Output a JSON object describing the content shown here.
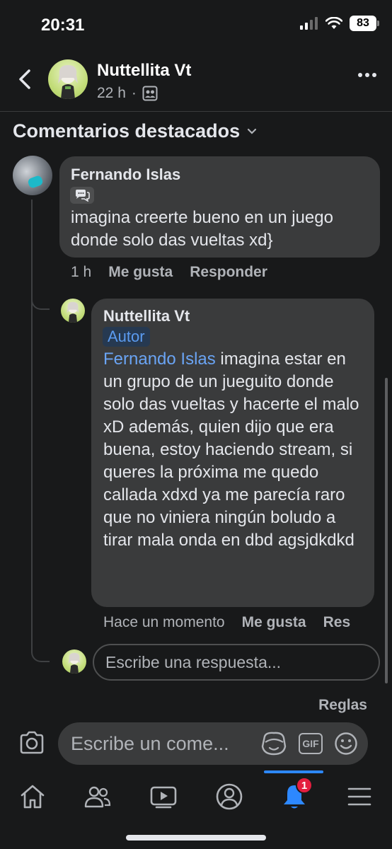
{
  "status_bar": {
    "time": "20:31",
    "battery": "83"
  },
  "header": {
    "name": "Nuttellita Vt",
    "time_ago": "22 h",
    "separator": "·"
  },
  "section": {
    "title": "Comentarios destacados"
  },
  "comment": {
    "author": "Fernando Islas",
    "text": "imagina creerte bueno en un juego donde solo das vueltas xd}",
    "time": "1 h",
    "like_label": "Me gusta",
    "reply_label": "Responder"
  },
  "reply": {
    "author": "Nuttellita Vt",
    "badge": "Autor",
    "mention": "Fernando Islas",
    "text": " imagina estar en un grupo de un jueguito donde solo das vueltas y hacerte el malo xD además, quien dijo que era buena, estoy haciendo stream, si queres la próxima me quedo callada xdxd ya me parecía raro que no viniera ningún boludo a tirar mala onda en dbd agsjdkdkd",
    "time": "Hace un momento",
    "like_label": "Me gusta",
    "reply_label": "Res"
  },
  "reply_input": {
    "placeholder": "Escribe una respuesta..."
  },
  "rules_link": "Reglas",
  "comment_bar": {
    "placeholder": "Escribe un come...",
    "gif_label": "GIF"
  },
  "bottom_nav": {
    "notifications_count": "1"
  },
  "colors": {
    "background": "#18191a",
    "bubble": "#3a3b3c",
    "accent": "#2d88ff",
    "mention": "#6aa4f4",
    "badge": "#e41e3f"
  }
}
